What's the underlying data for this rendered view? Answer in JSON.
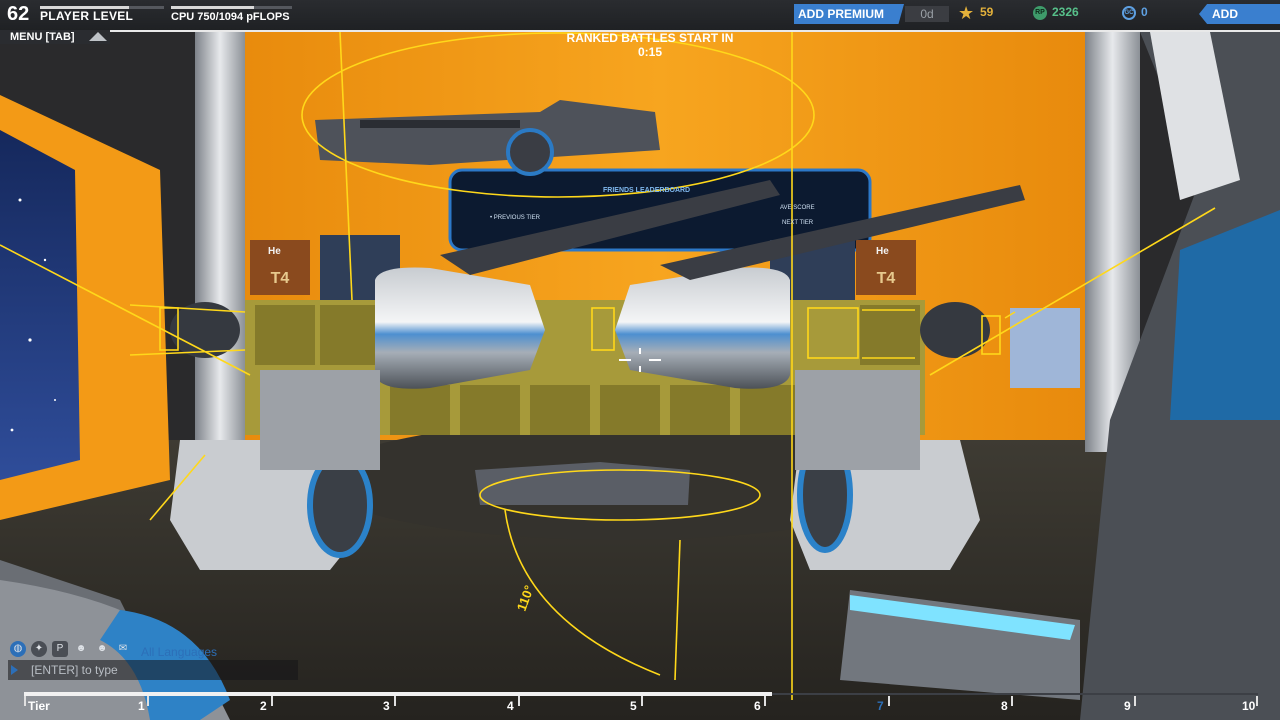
{
  "hud": {
    "player_level": "62",
    "player_level_label": "PLAYER LEVEL",
    "cpu": "CPU 750/1094 pFLOPS",
    "menu_label": "MENU [TAB]",
    "countdown": "RANKED BATTLES START IN 0:15",
    "premium_button": "ADD PREMIUM",
    "premium_days": "0d",
    "stars": "59",
    "robits": "2326",
    "cosmetic_credits": "0",
    "funds_button": "ADD FUNDS",
    "icons": [
      "star-icon",
      "rp-icon",
      "gc-icon"
    ],
    "accent_blue": "#3a7fcf",
    "bars": {
      "level_progress": 0.72,
      "cpu_progress": 0.69
    }
  },
  "scene_labels": {
    "leaderboard_title": "FRIENDS LEADERBOARD",
    "leaderboard_left": "• PREVIOUS TIER",
    "leaderboard_right": "AVE SCORE",
    "leaderboard_next": "NEXT TIER",
    "cube_label": "He",
    "tier_badge": "T4",
    "angle_label": "110°"
  },
  "chat": {
    "language": "All Languages",
    "placeholder": "[ENTER] to type",
    "icons": [
      "globe-icon",
      "team-icon",
      "party-icon",
      "friends-icon",
      "clan-icon",
      "private-icon"
    ]
  },
  "tier_bar": {
    "title": "Tier",
    "labels": [
      "1",
      "2",
      "3",
      "4",
      "5",
      "6",
      "7",
      "8",
      "9",
      "10"
    ],
    "current_tier": 7,
    "progress": 0.606
  },
  "colors": {
    "wireframe": "#ffd81a",
    "background_orange": "#f39a16",
    "tier_fill": "#f1f1f1"
  }
}
